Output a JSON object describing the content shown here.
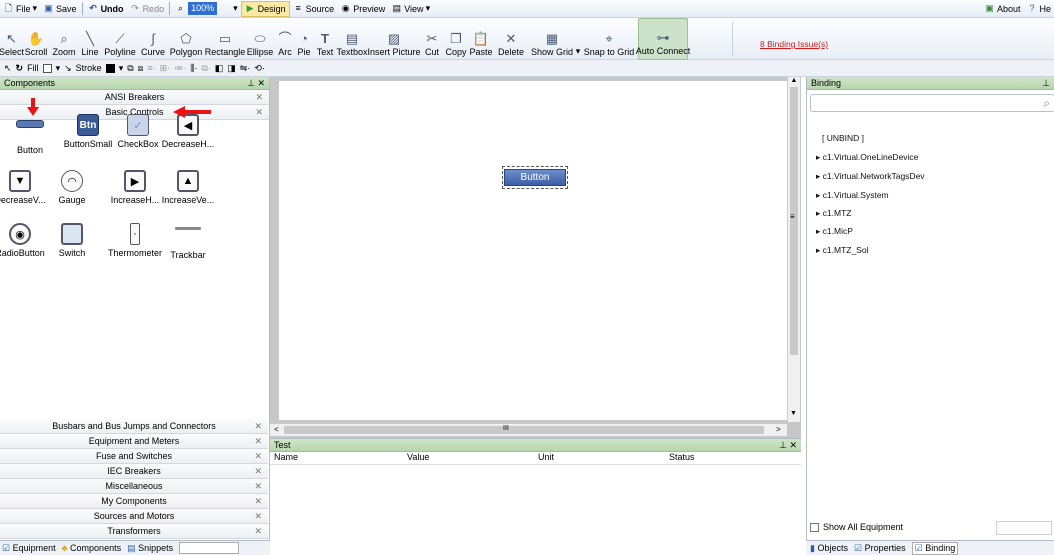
{
  "menubar": {
    "file": "File",
    "save": "Save",
    "undo": "Undo",
    "redo": "Redo",
    "zoom": "100%",
    "design": "Design",
    "source": "Source",
    "preview": "Preview",
    "view": "View",
    "about": "About",
    "help": "He"
  },
  "toolbar": {
    "tools": [
      "Select",
      "Scroll",
      "Zoom",
      "Line",
      "Polyline",
      "Curve",
      "Polygon",
      "Rectangle",
      "Ellipse",
      "Arc",
      "Pie",
      "Text",
      "Textbox",
      "Insert Picture",
      "Cut",
      "Copy",
      "Paste",
      "Delete",
      "Show Grid",
      "Snap to Grid",
      "Auto Connect"
    ],
    "binding_issues": "8 Binding Issue(s)"
  },
  "formatbar": {
    "fill": "Fill",
    "stroke": "Stroke"
  },
  "components": {
    "title": "Components",
    "top_categories": [
      "ANSI Breakers",
      "Basic Controls"
    ],
    "items": [
      "Button",
      "ButtonSmall",
      "CheckBox",
      "DecreaseH...",
      "DecreaseV...",
      "Gauge",
      "IncreaseH...",
      "IncreaseVe...",
      "RadioButton",
      "Switch",
      "Thermometer",
      "Trackbar"
    ],
    "small_btn_text": "Btn",
    "bottom_categories": [
      "Busbars and Bus Jumps and Connectors",
      "Equipment and Meters",
      "Fuse and Switches",
      "IEC Breakers",
      "Miscellaneous",
      "My Components",
      "Sources and Motors",
      "Transformers"
    ]
  },
  "bottom_tabs": [
    "Equipment",
    "Components",
    "Snippets"
  ],
  "canvas": {
    "button_label": "Button",
    "hscroll": "III"
  },
  "test_panel": {
    "title": "Test",
    "columns": [
      "Name",
      "Value",
      "Unit",
      "Status"
    ]
  },
  "binding": {
    "title": "Binding",
    "search_placeholder": "",
    "items": [
      "[ UNBIND ]",
      "c1.Virtual.OneLineDevice",
      "c1.Virtual.NetworkTagsDev",
      "c1.Virtual.System",
      "c1.MTZ",
      "c1.MicP",
      "c1.MTZ_Sol"
    ],
    "show_all": "Show All Equipment",
    "tabs": [
      "Objects",
      "Properties",
      "Binding"
    ]
  }
}
